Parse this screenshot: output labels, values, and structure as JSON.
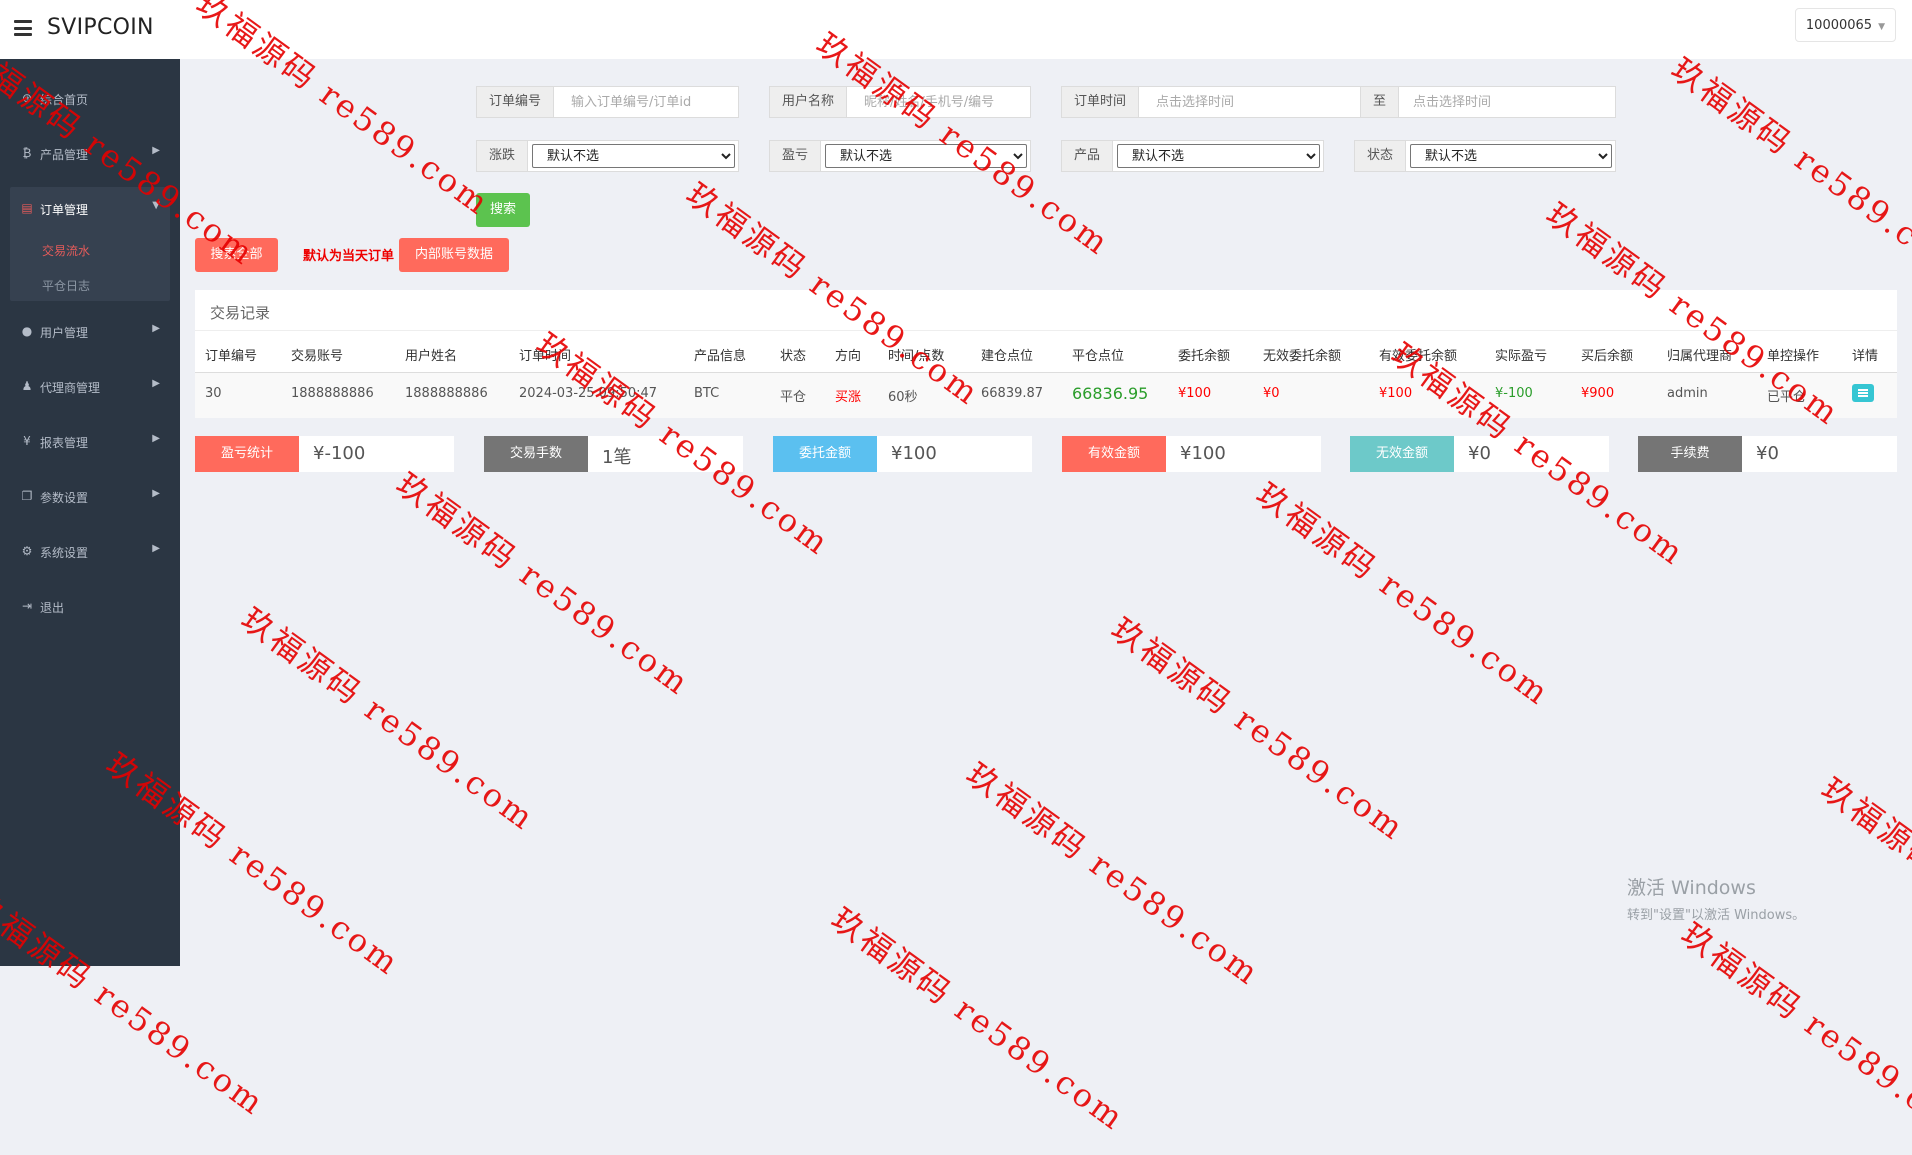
{
  "app": {
    "brand": "SVIPCOIN",
    "user_id": "10000065"
  },
  "sidebar": {
    "items": [
      {
        "label": "综合首页",
        "icon": "dashboard-icon",
        "has_arrow": false
      },
      {
        "label": "产品管理",
        "icon": "bitcoin-icon",
        "has_arrow": true
      },
      {
        "label": "订单管理",
        "icon": "orders-icon",
        "has_arrow": true
      },
      {
        "label": "用户管理",
        "icon": "user-icon",
        "has_arrow": true
      },
      {
        "label": "代理商管理",
        "icon": "agent-icon",
        "has_arrow": true
      },
      {
        "label": "报表管理",
        "icon": "yen-icon",
        "has_arrow": true
      },
      {
        "label": "参数设置",
        "icon": "copy-icon",
        "has_arrow": true
      },
      {
        "label": "系统设置",
        "icon": "gears-icon",
        "has_arrow": true
      },
      {
        "label": "退出",
        "icon": "logout-icon",
        "has_arrow": false
      }
    ],
    "subitems": [
      "交易流水",
      "平仓日志"
    ]
  },
  "filters": {
    "order_no": {
      "label": "订单编号",
      "placeholder": "输入订单编号/订单id"
    },
    "user_name": {
      "label": "用户名称",
      "placeholder": "昵称/姓名/手机号/编号"
    },
    "order_time": {
      "label": "订单时间",
      "placeholder": "点击选择时间"
    },
    "to": {
      "label": "至",
      "placeholder": "点击选择时间"
    },
    "updown": {
      "label": "涨跌",
      "value": "默认不选"
    },
    "profit": {
      "label": "盈亏",
      "value": "默认不选"
    },
    "product": {
      "label": "产品",
      "value": "默认不选"
    },
    "status": {
      "label": "状态",
      "value": "默认不选"
    },
    "search_button": "搜索"
  },
  "actions": {
    "search_all": "搜索全部",
    "default_note": "默认为当天订单",
    "internal": "内部账号数据"
  },
  "table": {
    "title": "交易记录",
    "columns": [
      "订单编号",
      "交易账号",
      "用户姓名",
      "订单时间",
      "产品信息",
      "状态",
      "方向",
      "时间/点数",
      "建仓点位",
      "平仓点位",
      "委托余额",
      "无效委托余额",
      "有效委托余额",
      "实际盈亏",
      "买后余额",
      "归属代理商",
      "单控操作",
      "详情"
    ],
    "rows": [
      {
        "order_no": "30",
        "account": "1888888886",
        "name": "1888888886",
        "time": "2024-03-25 09:50:47",
        "product": "BTC",
        "status": "平仓",
        "direction": "买涨",
        "duration": "60秒",
        "open_price": "66839.87",
        "close_price": "66836.95",
        "entrust": "¥100",
        "invalid": "¥0",
        "valid": "¥100",
        "pnl": "¥-100",
        "balance_after": "¥900",
        "agent": "admin",
        "control": "已平仓"
      }
    ]
  },
  "stats": [
    {
      "label": "盈亏统计",
      "value": "¥-100",
      "color": "#ff6a5c"
    },
    {
      "label": "交易手数",
      "value": "1笔",
      "color": "#757575"
    },
    {
      "label": "委托金额",
      "value": "¥100",
      "color": "#5bc0f0"
    },
    {
      "label": "有效金额",
      "value": "¥100",
      "color": "#ff6a5c"
    },
    {
      "label": "无效金额",
      "value": "¥0",
      "color": "#6dc9c9"
    },
    {
      "label": "手续费",
      "value": "¥0",
      "color": "#757575"
    }
  ],
  "windows": {
    "line1": "激活 Windows",
    "line2": "转到\"设置\"以激活 Windows。"
  },
  "watermark": "玖福源码 re589.com",
  "colors": {
    "sidebar_bg": "#2b3643",
    "accent_red": "#ff6a5c",
    "search_green": "#5cc34f",
    "watermark_red": "#e60000"
  }
}
